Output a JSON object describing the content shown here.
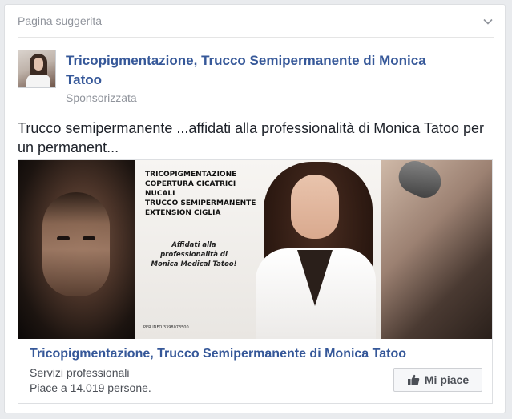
{
  "card": {
    "header_title": "Pagina suggerita",
    "chevron_icon": "chevron-down-icon"
  },
  "page": {
    "name": "Tricopigmentazione, Trucco Semipermanente di Monica Tatoo",
    "sponsored_label": "Sponsorizzata",
    "avatar_icon": "page-avatar"
  },
  "post": {
    "text": "Trucco semipermanente ...affidati alla professionalità di Monica Tatoo per un permanent..."
  },
  "ad": {
    "image_text_lines": [
      "Tricopigmentazione",
      "Copertura cicatrici nucali",
      "Trucco semipermanente",
      "Extension ciglia"
    ],
    "image_italic_text": "Affidati alla professionalità di Monica Medical Tatoo!",
    "image_small_text": "PER INFO 3398073500",
    "title": "Tricopigmentazione, Trucco Semipermanente di Monica Tatoo",
    "category": "Servizi professionali",
    "likes": "Piace a 14.019 persone.",
    "like_button_label": "Mi piace",
    "like_icon": "thumbs-up-icon"
  },
  "colors": {
    "link_blue": "#365899",
    "muted_gray": "#90949c",
    "text_dark": "#1d2129",
    "background": "#e9ebee"
  }
}
